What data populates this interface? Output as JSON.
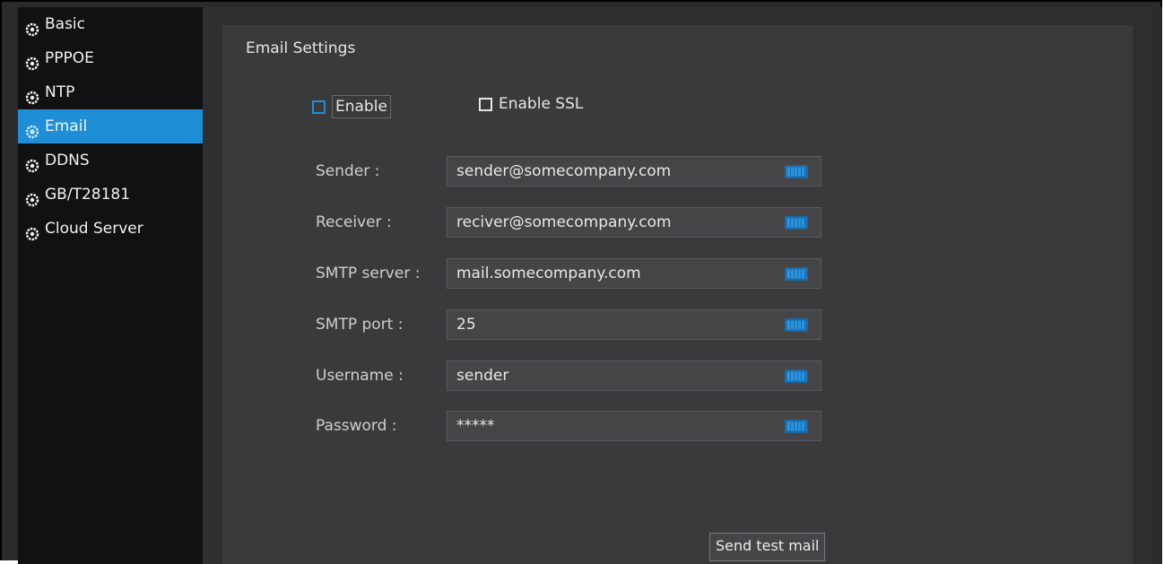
{
  "sidebar": {
    "items": [
      {
        "label": "Basic",
        "icon": "settings-gear-icon",
        "active": false
      },
      {
        "label": "PPPOE",
        "icon": "settings-gear-icon",
        "active": false
      },
      {
        "label": "NTP",
        "icon": "settings-gear-icon",
        "active": false
      },
      {
        "label": "Email",
        "icon": "settings-gear-icon",
        "active": true
      },
      {
        "label": "DDNS",
        "icon": "settings-gear-icon",
        "active": false
      },
      {
        "label": "GB/T28181",
        "icon": "settings-gear-icon",
        "active": false
      },
      {
        "label": "Cloud Server",
        "icon": "settings-gear-icon",
        "active": false
      }
    ],
    "active_color": "#1e8fd6"
  },
  "panel": {
    "title": "Email Settings",
    "enable_label": "Enable",
    "enable_ssl_label": "Enable SSL",
    "fields": [
      {
        "label": "Sender :",
        "value": "sender@somecompany.com"
      },
      {
        "label": "Receiver :",
        "value": "reciver@somecompany.com"
      },
      {
        "label": "SMTP server :",
        "value": "mail.somecompany.com"
      },
      {
        "label": "SMTP port :",
        "value": "25"
      },
      {
        "label": "Username :",
        "value": "sender"
      },
      {
        "label": "Password :",
        "value": "*****"
      }
    ],
    "send_test_label": "Send test mail"
  }
}
